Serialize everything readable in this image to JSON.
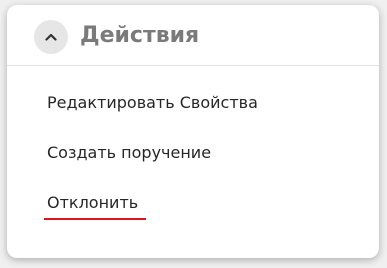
{
  "panel": {
    "title": "Действия",
    "collapse_icon": "chevron-up-icon"
  },
  "actions": [
    {
      "label": "Редактировать Свойства"
    },
    {
      "label": "Создать поручение"
    },
    {
      "label": "Отклонить"
    }
  ],
  "colors": {
    "accent_underline": "#d9161b",
    "title": "#7a7a7a",
    "text": "#262626"
  }
}
